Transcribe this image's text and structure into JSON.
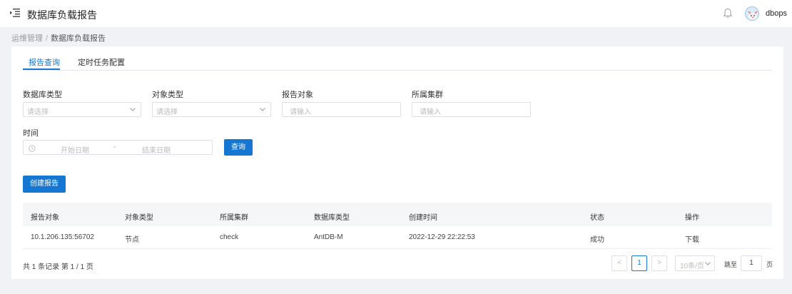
{
  "header": {
    "title": "数据库负载报告",
    "username": "dbops"
  },
  "breadcrumb": {
    "parent": "运维管理",
    "separator": "/",
    "current": "数据库负载报告"
  },
  "tabs": [
    {
      "label": "报告查询",
      "active": true
    },
    {
      "label": "定时任务配置",
      "active": false
    }
  ],
  "form": {
    "db_type": {
      "label": "数据库类型",
      "placeholder": "请选择"
    },
    "object_type": {
      "label": "对象类型",
      "placeholder": "请选择"
    },
    "report_object": {
      "label": "报告对象",
      "placeholder": "请输入"
    },
    "cluster": {
      "label": "所属集群",
      "placeholder": "请输入"
    },
    "time": {
      "label": "时间",
      "start_placeholder": "开始日期",
      "separator": "-",
      "end_placeholder": "结束日期"
    },
    "query_button": "查询"
  },
  "create_button": "创建报告",
  "table": {
    "columns": [
      "报告对象",
      "对象类型",
      "所属集群",
      "数据库类型",
      "创建时间",
      "状态",
      "操作"
    ],
    "rows": [
      [
        "10.1.206.135:56702",
        "节点",
        "check",
        "AntDB-M",
        "2022-12-29 22:22:53",
        "成功",
        "下载"
      ]
    ]
  },
  "pagination": {
    "summary": "共 1 条记录 第 1 / 1 页",
    "prev": "<",
    "current_page": "1",
    "next": ">",
    "page_size": "10条/页",
    "jump_label": "跳至",
    "jump_value": "1",
    "page_suffix": "页"
  },
  "colors": {
    "primary": "#1677d2",
    "background": "#f0f2f5"
  },
  "icons": {
    "menu": "menu-fold-icon",
    "bell": "bell-icon",
    "calendar": "clock-icon",
    "chevron": "chevron-down-icon"
  }
}
